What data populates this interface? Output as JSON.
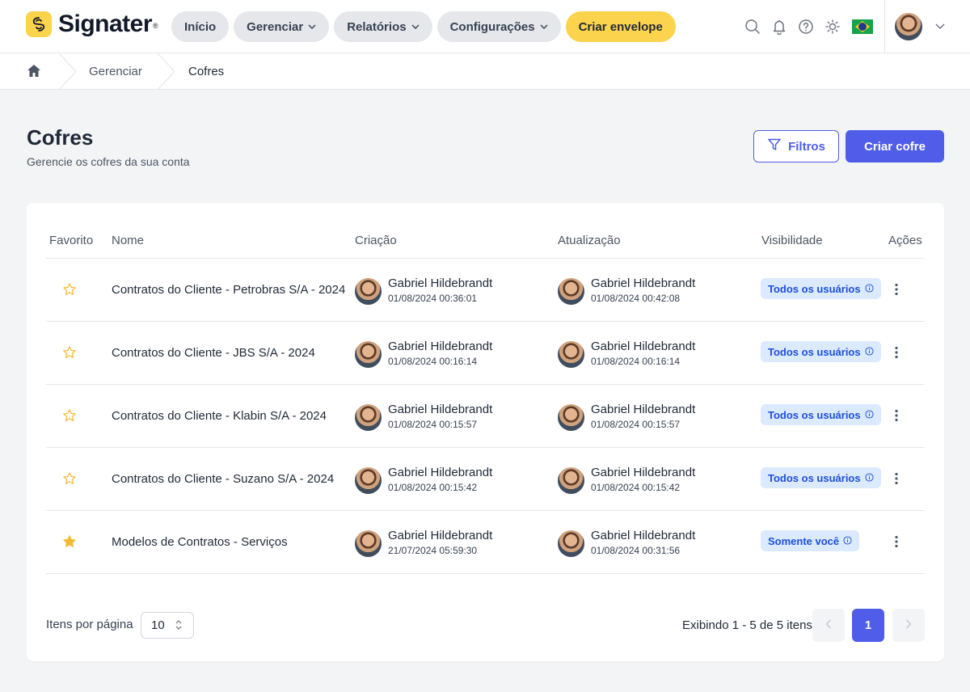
{
  "app": {
    "brand": "Signater",
    "brand_mark": "®"
  },
  "nav": {
    "inicio": "Início",
    "gerenciar": "Gerenciar",
    "relatorios": "Relatórios",
    "configuracoes": "Configurações",
    "criar_envelope": "Criar envelope"
  },
  "header_icons": [
    "search-icon",
    "bell-icon",
    "help-icon",
    "sun-icon",
    "brazil-flag-icon"
  ],
  "breadcrumb": {
    "items": [
      "Gerenciar",
      "Cofres"
    ]
  },
  "page": {
    "title": "Cofres",
    "subtitle": "Gerencie os cofres da sua conta",
    "filters_label": "Filtros",
    "create_label": "Criar cofre"
  },
  "table": {
    "headers": {
      "favorite": "Favorito",
      "name": "Nome",
      "created": "Criação",
      "updated": "Atualização",
      "visibility": "Visibilidade",
      "actions": "Ações"
    },
    "rows": [
      {
        "favorite": false,
        "name": "Contratos do Cliente - Petrobras S/A - 2024",
        "created_by": "Gabriel Hildebrandt",
        "created_at": "01/08/2024 00:36:01",
        "updated_by": "Gabriel Hildebrandt",
        "updated_at": "01/08/2024 00:42:08",
        "visibility": "Todos os usuários"
      },
      {
        "favorite": false,
        "name": "Contratos do Cliente - JBS S/A - 2024",
        "created_by": "Gabriel Hildebrandt",
        "created_at": "01/08/2024 00:16:14",
        "updated_by": "Gabriel Hildebrandt",
        "updated_at": "01/08/2024 00:16:14",
        "visibility": "Todos os usuários"
      },
      {
        "favorite": false,
        "name": "Contratos do Cliente - Klabin S/A - 2024",
        "created_by": "Gabriel Hildebrandt",
        "created_at": "01/08/2024 00:15:57",
        "updated_by": "Gabriel Hildebrandt",
        "updated_at": "01/08/2024 00:15:57",
        "visibility": "Todos os usuários"
      },
      {
        "favorite": false,
        "name": "Contratos do Cliente - Suzano S/A - 2024",
        "created_by": "Gabriel Hildebrandt",
        "created_at": "01/08/2024 00:15:42",
        "updated_by": "Gabriel Hildebrandt",
        "updated_at": "01/08/2024 00:15:42",
        "visibility": "Todos os usuários"
      },
      {
        "favorite": true,
        "name": "Modelos de Contratos - Serviços",
        "created_by": "Gabriel Hildebrandt",
        "created_at": "21/07/2024 05:59:30",
        "updated_by": "Gabriel Hildebrandt",
        "updated_at": "01/08/2024 00:31:56",
        "visibility": "Somente você"
      }
    ]
  },
  "footer": {
    "items_per_page_label": "Itens por página",
    "items_per_page_value": "10",
    "showing": "Exibindo 1 - 5 de 5 itens",
    "current_page": "1"
  },
  "colors": {
    "accent": "#4f5de8",
    "brand_yellow": "#fcd34d",
    "badge_bg": "#dbeafe",
    "badge_text": "#1d4ed8",
    "star": "#f5b82e"
  }
}
